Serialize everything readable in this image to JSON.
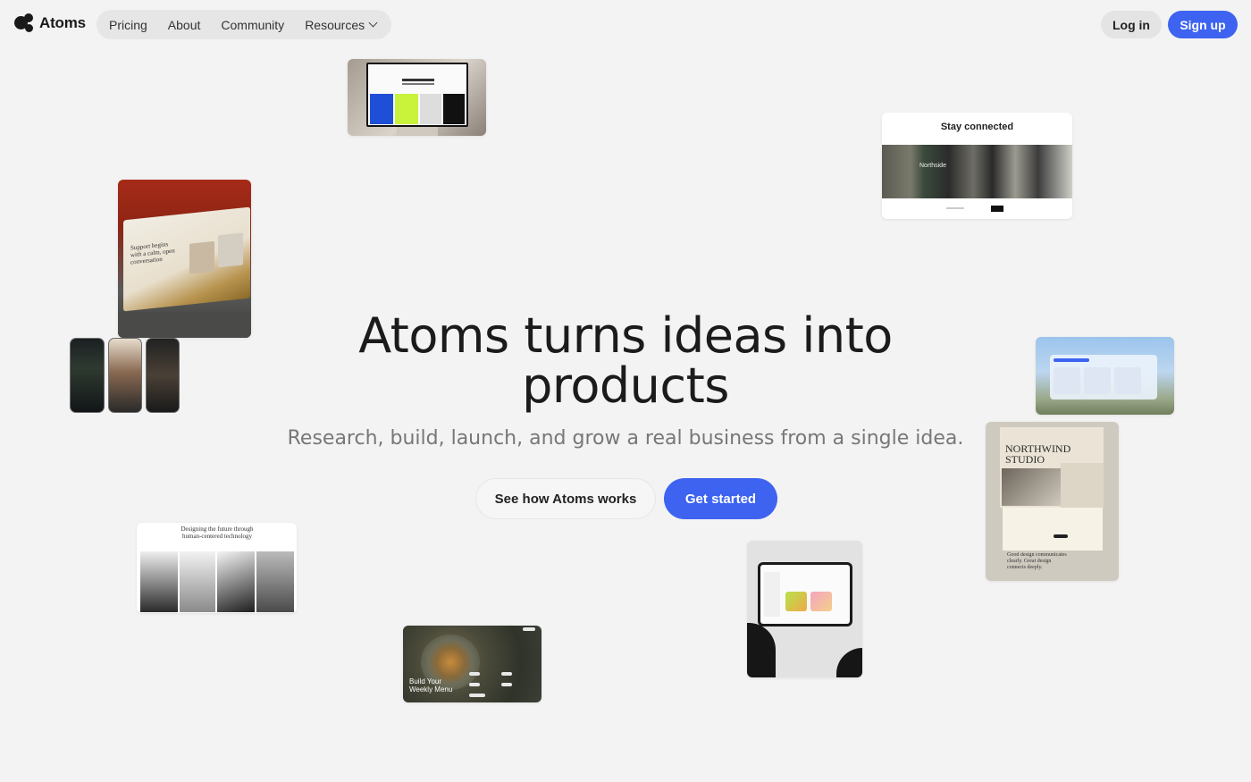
{
  "brand": {
    "name": "Atoms"
  },
  "nav": {
    "items": [
      {
        "label": "Pricing"
      },
      {
        "label": "About"
      },
      {
        "label": "Community"
      },
      {
        "label": "Resources"
      }
    ],
    "login": "Log in",
    "signup": "Sign up"
  },
  "hero": {
    "title": "Atoms turns ideas into products",
    "subtitle": "Research, build, launch, and grow a real business from a single idea.",
    "secondary_cta": "See how Atoms works",
    "primary_cta": "Get started"
  },
  "showcase": {
    "stay_connected": "Stay connected",
    "northwind_title": "NORTHWIND STUDIO",
    "northwind_tagline": "Good design communicates clearly. Great design connects deeply.",
    "future_tech": "Designing the future through human-centered technology",
    "weekly_menu": "Build Your Weekly Menu",
    "northside": "Northside",
    "support_text": "Support begins with a calm, open conversation"
  },
  "colors": {
    "accent": "#3d63f0",
    "background": "#f3f3f3"
  }
}
